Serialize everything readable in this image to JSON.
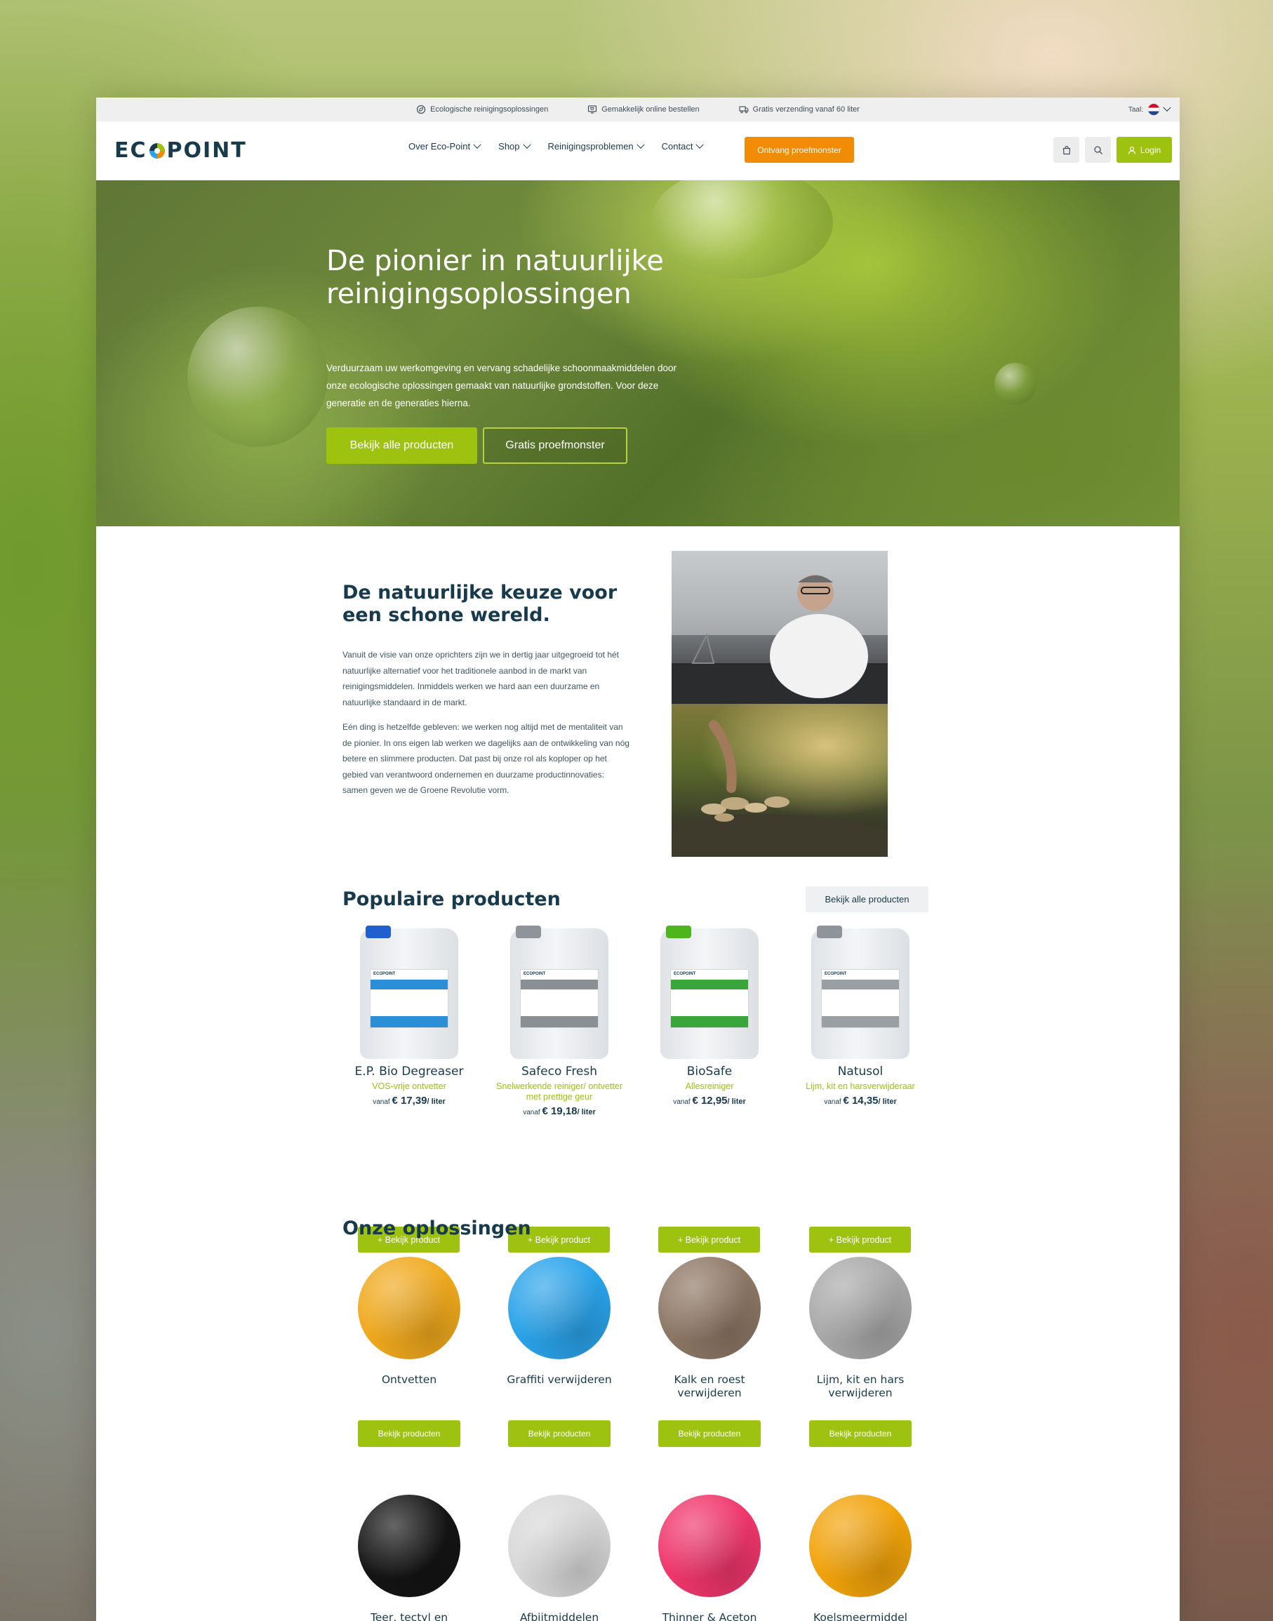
{
  "colors": {
    "primary_green": "#9dc20f",
    "orange": "#f28c06",
    "navy": "#173a4c"
  },
  "infobar": {
    "items": [
      {
        "icon": "leaf-circle-icon",
        "text": "Ecologische reinigingsoplossingen"
      },
      {
        "icon": "screen-cart-icon",
        "text": "Gemakkelijk online bestellen"
      },
      {
        "icon": "truck-icon",
        "text": "Gratis verzending vanaf 60 liter"
      }
    ],
    "language_label": "Taal:"
  },
  "header": {
    "logo": "ECOPOINT",
    "nav": [
      "Over Eco-Point",
      "Shop",
      "Reinigingsproblemen",
      "Contact"
    ],
    "cta": "Ontvang proefmonster",
    "login": "Login"
  },
  "hero": {
    "title": "De pionier in natuurlijke reinigingsoplossingen",
    "text": "Verduurzaam uw werkomgeving en vervang schadelijke schoonmaakmiddelen door onze ecologische oplossingen gemaakt van natuurlijke grondstoffen. Voor deze generatie en de generaties hierna.",
    "btn_primary": "Bekijk alle producten",
    "btn_secondary": "Gratis proefmonster"
  },
  "intro": {
    "title": "De natuurlijke keuze voor een schone wereld.",
    "p1": "Vanuit de visie van onze oprichters zijn we in dertig jaar uitgegroeid tot hét natuurlijke alternatief voor het traditionele aanbod in de markt van reinigingsmiddelen. Inmiddels werken we hard aan een duurzame en natuurlijke standaard in de markt.",
    "p2": "Eén ding is hetzelfde gebleven: we werken nog altijd met de mentaliteit van de pionier. In ons eigen lab werken we dagelijks aan de ontwikkeling van nóg betere en slimmere producten. Dat past bij onze rol als koploper op het gebied van verantwoord ondernemen en duurzame productinnovaties: samen geven we de Groene Revolutie vorm."
  },
  "products": {
    "title": "Populaire producten",
    "view_all": "Bekijk alle producten",
    "price_prefix": "vanaf",
    "button": "+ Bekijk product",
    "items": [
      {
        "name": "E.P. Bio Degreaser",
        "subtitle": "VOS-vrije ontvetter",
        "price": "€ 17,39",
        "unit": "/ liter",
        "cap_color": "#1f5fd0",
        "band_color": "#2a8fd6"
      },
      {
        "name": "Safeco Fresh",
        "subtitle": "Snelwerkende reiniger/ ontvetter met prettige geur",
        "price": "€ 19,18",
        "unit": "/ liter",
        "cap_color": "#8e9499",
        "band_color": "#8a8f94"
      },
      {
        "name": "BioSafe",
        "subtitle": "Allesreiniger",
        "price": "€ 12,95",
        "unit": "/ liter",
        "cap_color": "#4fb51e",
        "band_color": "#3aa53a"
      },
      {
        "name": "Natusol",
        "subtitle": "Lijm, kit en harsverwijderaar",
        "price": "€ 14,35",
        "unit": "/ liter",
        "cap_color": "#8e9499",
        "band_color": "#9a9fa3"
      }
    ]
  },
  "solutions": {
    "title": "Onze oplossingen",
    "button": "Bekijk producten",
    "items": [
      {
        "name": "Ontvetten",
        "color": "#f0a91d"
      },
      {
        "name": "Graffiti verwijderen",
        "color": "#2aa3ea"
      },
      {
        "name": "Kalk en roest verwijderen",
        "color": "#8d7765"
      },
      {
        "name": "Lijm, kit en hars verwijderen",
        "color": "#a9a9a9"
      },
      {
        "name": "Teer, tectyl en",
        "color": "#141414"
      },
      {
        "name": "Afbijtmiddelen",
        "color": "#d8d8d8"
      },
      {
        "name": "Thinner & Aceton",
        "color": "#f0366b"
      },
      {
        "name": "Koelsmeermiddel",
        "color": "#f2a30b"
      }
    ]
  }
}
